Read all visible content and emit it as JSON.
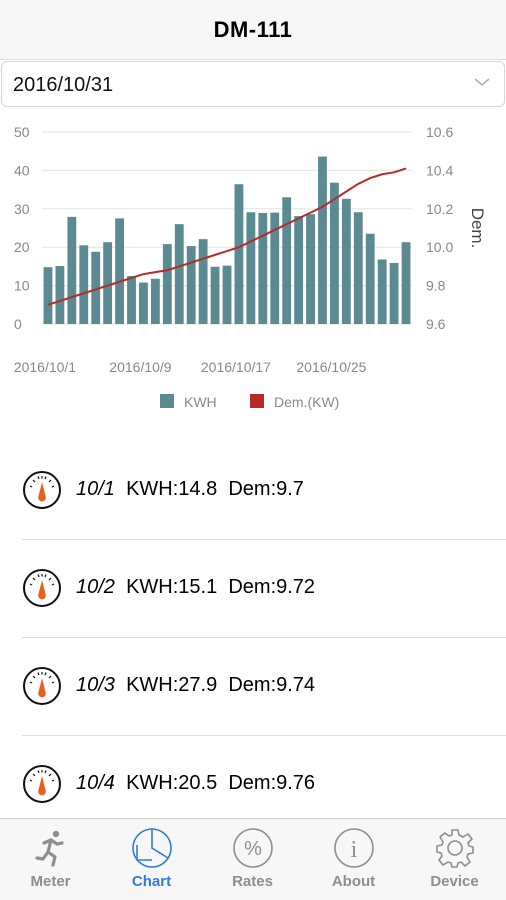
{
  "header": {
    "title": "DM-111"
  },
  "date_select": {
    "value": "2016/10/31"
  },
  "chart_data": {
    "type": "bar",
    "categories": [
      "10/1",
      "10/2",
      "10/3",
      "10/4",
      "10/5",
      "10/6",
      "10/7",
      "10/8",
      "10/9",
      "10/10",
      "10/11",
      "10/12",
      "10/13",
      "10/14",
      "10/15",
      "10/16",
      "10/17",
      "10/18",
      "10/19",
      "10/20",
      "10/21",
      "10/22",
      "10/23",
      "10/24",
      "10/25",
      "10/26",
      "10/27",
      "10/28",
      "10/29",
      "10/30",
      "10/31"
    ],
    "x_tick_labels": [
      "2016/10/1",
      "2016/10/9",
      "2016/10/17",
      "2016/10/25"
    ],
    "x_tick_indices": [
      0,
      8,
      16,
      24
    ],
    "series": [
      {
        "name": "KWH",
        "axis": "left",
        "type": "bar",
        "color": "#5b8a93",
        "values": [
          14.8,
          15.1,
          27.9,
          20.5,
          18.8,
          21.3,
          27.5,
          12.5,
          10.8,
          11.8,
          20.8,
          26.0,
          20.3,
          22.1,
          14.9,
          15.2,
          36.4,
          29.1,
          28.9,
          29.0,
          33.0,
          28.1,
          28.6,
          43.6,
          36.8,
          32.6,
          29.1,
          23.5,
          16.8,
          15.9,
          21.3
        ]
      },
      {
        "name": "Dem.(KW)",
        "axis": "right",
        "type": "line",
        "color": "#b52b27",
        "values": [
          9.7,
          9.72,
          9.74,
          9.76,
          9.78,
          9.8,
          9.82,
          9.84,
          9.86,
          9.87,
          9.88,
          9.9,
          9.92,
          9.94,
          9.96,
          9.98,
          10.0,
          10.03,
          10.06,
          10.09,
          10.12,
          10.15,
          10.18,
          10.21,
          10.25,
          10.29,
          10.33,
          10.36,
          10.38,
          10.39,
          10.41
        ]
      }
    ],
    "y_left": {
      "ticks": [
        0,
        10,
        20,
        30,
        40,
        50
      ],
      "min": 0,
      "max": 50
    },
    "y_right": {
      "label": "Dem.",
      "ticks": [
        "9.6",
        "9.8",
        "10.0",
        "10.2",
        "10.4",
        "10.6"
      ],
      "min": 9.6,
      "max": 10.6
    },
    "grid": true,
    "legend_position": "bottom"
  },
  "readings": [
    {
      "date": "10/1",
      "kwh": "KWH:14.8",
      "dem": "Dem:9.7"
    },
    {
      "date": "10/2",
      "kwh": "KWH:15.1",
      "dem": "Dem:9.72"
    },
    {
      "date": "10/3",
      "kwh": "KWH:27.9",
      "dem": "Dem:9.74"
    },
    {
      "date": "10/4",
      "kwh": "KWH:20.5",
      "dem": "Dem:9.76"
    }
  ],
  "tabs": [
    {
      "label": "Meter",
      "icon": "runner-icon",
      "active": false
    },
    {
      "label": "Chart",
      "icon": "pie-chart-icon",
      "active": true
    },
    {
      "label": "Rates",
      "icon": "percent-icon",
      "active": false
    },
    {
      "label": "About",
      "icon": "info-icon",
      "active": false
    },
    {
      "label": "Device",
      "icon": "gear-icon",
      "active": false
    }
  ],
  "colors": {
    "accent": "#2f7cdb",
    "inactive": "#8e8e8e",
    "bar": "#5b8a93",
    "line": "#b52b27",
    "gauge_needle": "#e8601c"
  }
}
